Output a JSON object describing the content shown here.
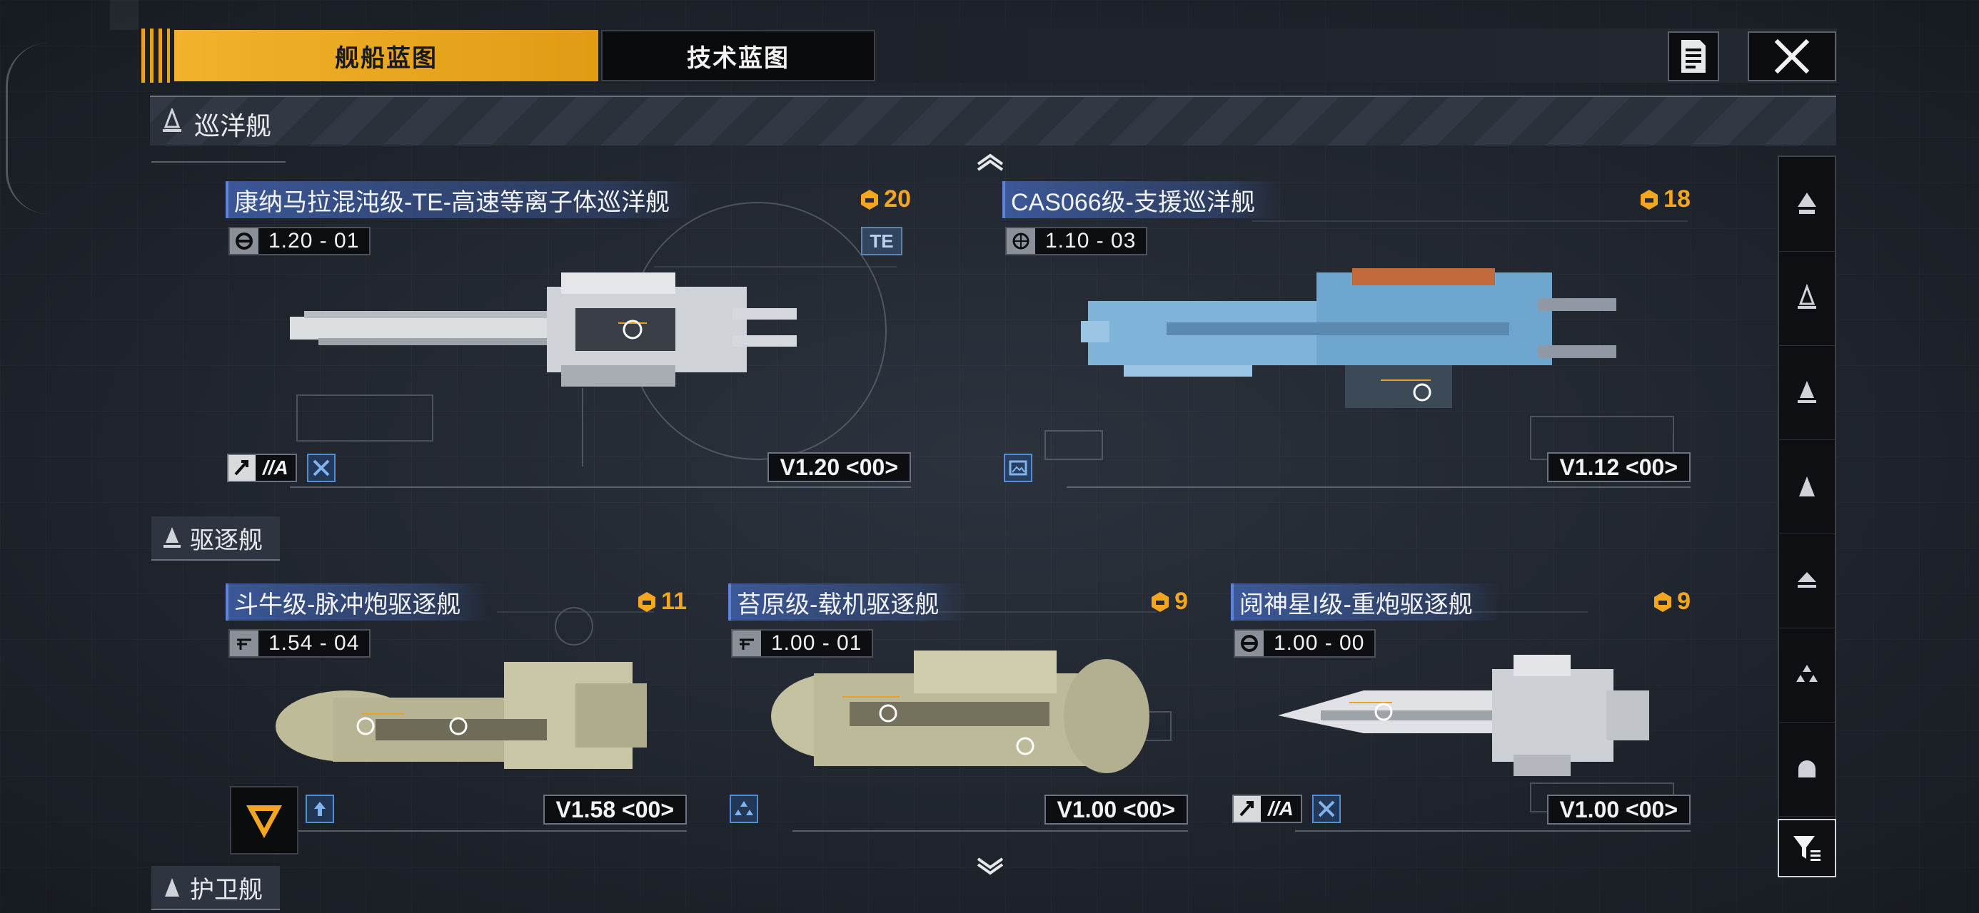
{
  "tabs": {
    "ship_blueprint": "舰船蓝图",
    "tech_blueprint": "技术蓝图"
  },
  "sections": {
    "cruiser": "巡洋舰",
    "destroyer": "驱逐舰",
    "frigate": "护卫舰"
  },
  "colors": {
    "accent": "#f0b32a",
    "cost": "#f4a621",
    "title_band": "#4060aa"
  },
  "cards": [
    {
      "title": "康纳马拉混沌级-TE-高速等离子体巡洋舰",
      "cost": "20",
      "version": "1.20 - 01",
      "tag": "TE",
      "role": "//A",
      "bottom_version": "V1.20 <00>",
      "hull": "white"
    },
    {
      "title": "CAS066级-支援巡洋舰",
      "cost": "18",
      "version": "1.10 - 03",
      "bottom_version": "V1.12 <00>",
      "hull": "blue"
    },
    {
      "title": "斗牛级-脉冲炮驱逐舰",
      "cost": "11",
      "version": "1.54 - 04",
      "bottom_version": "V1.58 <00>",
      "hull": "olive"
    },
    {
      "title": "苔原级-载机驱逐舰",
      "cost": "9",
      "version": "1.00 - 01",
      "bottom_version": "V1.00 <00>",
      "hull": "olive2"
    },
    {
      "title": "阋神星I级-重炮驱逐舰",
      "cost": "9",
      "version": "1.00 - 00",
      "role": "//A",
      "bottom_version": "V1.00 <00>",
      "hull": "white2"
    }
  ],
  "icons": {
    "doc": "document-icon",
    "close": "close-icon",
    "cost": "hexagon-cost-icon",
    "filter": "filter-icon"
  }
}
